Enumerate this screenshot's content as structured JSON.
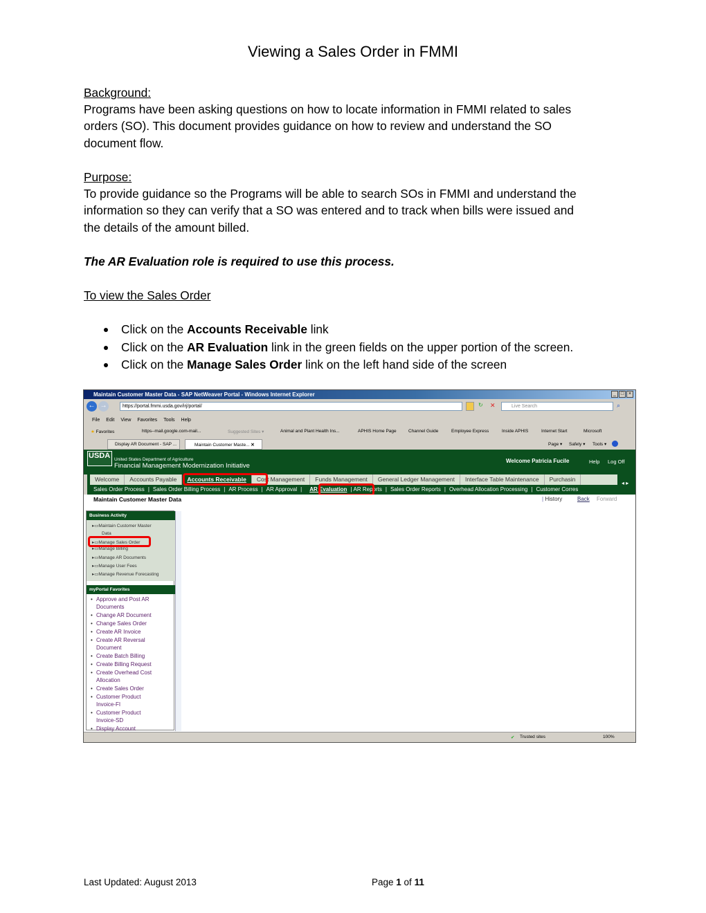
{
  "document": {
    "title": "Viewing a Sales Order in FMMI",
    "background_heading": "Background:",
    "background_lines": [
      "Programs have been asking questions on how to locate information in FMMI related to sales",
      "orders (SO).  This document provides guidance on how to review and understand the SO",
      "document flow."
    ],
    "purpose_heading": "Purpose:",
    "purpose_lines": [
      "To provide guidance so the Programs will be able to search SOs in FMMI and understand the",
      "information so they can verify that a SO was entered and to track when bills were issued and",
      "the details of the amount billed."
    ],
    "role_note": "The AR Evaluation role is required to use this process.",
    "section_heading": "To view the Sales Order",
    "bullets": [
      {
        "pre": "Click on the ",
        "bold": "Accounts Receivable",
        "post": " link"
      },
      {
        "pre": "Click on the ",
        "bold": "AR Evaluation",
        "post": " link in the green fields on the upper portion of the screen."
      },
      {
        "pre": "Click on the ",
        "bold": "Manage Sales Order",
        "post": " link on the left hand side of the screen"
      }
    ],
    "footer_left": "Last Updated:  August 2013",
    "footer_page_pre": "Page ",
    "footer_page_num": "1",
    "footer_page_mid": " of ",
    "footer_page_total": "11"
  },
  "screenshot": {
    "window_title": "Maintain Customer Master Data - SAP NetWeaver Portal - Windows Internet Explorer",
    "address": "https://portal.fmmi.usda.gov/irj/portal/",
    "search_placeholder": "Live Search",
    "menu": [
      "File",
      "Edit",
      "View",
      "Favorites",
      "Tools",
      "Help"
    ],
    "favorites_label": "Favorites",
    "favorites": [
      "https--mail.google.com-mail...",
      "Suggested Sites ▾",
      "Animal and Plant Health Ins...",
      "APHIS Home Page",
      "Channel Guide",
      "Employee Express",
      "Inside APHIS",
      "Internet Start",
      "Microsoft"
    ],
    "browser_tabs": [
      "Display AR Document - SAP ...",
      "Maintain Customer Maste..."
    ],
    "command_bar": [
      "Page ▾",
      "Safety ▾",
      "Tools ▾"
    ],
    "logo": "USDA",
    "org_line1": "United States Department of Agriculture",
    "org_line2": "Financial Management Modernization Initiative",
    "welcome": "Welcome Patricia Fucile",
    "help": "Help",
    "logoff": "Log Off",
    "top_tabs": [
      "Welcome",
      "Accounts Payable",
      "Accounts Receivable",
      "Cost Management",
      "Funds Management",
      "General Ledger Management",
      "Interface Table Maintenance",
      "Purchasin"
    ],
    "sub_tabs": [
      "Sales Order Process",
      "Sales Order Billing Process",
      "AR Process",
      "AR Approval",
      "AR Evaluation",
      "AR Reports",
      "Sales Order Reports",
      "Overhead Allocation Processing",
      "Customer Corres"
    ],
    "page_title": "Maintain Customer Master Data",
    "history": "History",
    "back": "Back",
    "forward": "Forward",
    "business_activity_title": "Business Activity",
    "business_activity": [
      "Maintain Customer Master",
      "Data",
      "Manage Sales Order",
      "Manage Billing",
      "Manage AR Documents",
      "Manage User Fees",
      "Manage Revenue Forecasting"
    ],
    "favorites_panel_title": "myPortal Favorites",
    "favorite_links": [
      "Approve and Post AR",
      "Documents",
      "Change AR Document",
      "Change Sales Order",
      "Create AR Invoice",
      "Create AR Reversal",
      "Document",
      "Create Batch Billing",
      "Create Billing Request",
      "Create Overhead Cost",
      "Allocation",
      "Create Sales Order",
      "Customer Product",
      "Invoice-FI",
      "Customer Product",
      "Invoice-SD",
      "Display Account"
    ],
    "status_zone": "Trusted sites",
    "zoom": "100%",
    "highlight_color": "#e00000",
    "portal_green": "#0b4f1e"
  }
}
